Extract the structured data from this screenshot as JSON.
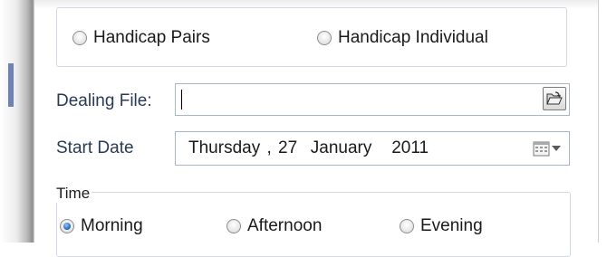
{
  "game_type": {
    "options": [
      {
        "label": "Handicap Pairs",
        "checked": false
      },
      {
        "label": "Handicap Individual",
        "checked": false
      }
    ]
  },
  "dealing_file": {
    "label": "Dealing File:",
    "value": "",
    "browse_icon": "folder-open-icon"
  },
  "start_date": {
    "label": "Start Date",
    "weekday": "Thursday",
    "separator": ",",
    "day": "27",
    "month": "January",
    "year": "2011",
    "calendar_icon": "calendar-dropdown-icon"
  },
  "time": {
    "label": "Time",
    "options": [
      {
        "label": "Morning",
        "checked": true
      },
      {
        "label": "Afternoon",
        "checked": false
      },
      {
        "label": "Evening",
        "checked": false
      }
    ]
  },
  "colors": {
    "label_text": "#2a3a55",
    "group_border": "#d2d9e4",
    "radio_selected": "#2e6bc4"
  }
}
